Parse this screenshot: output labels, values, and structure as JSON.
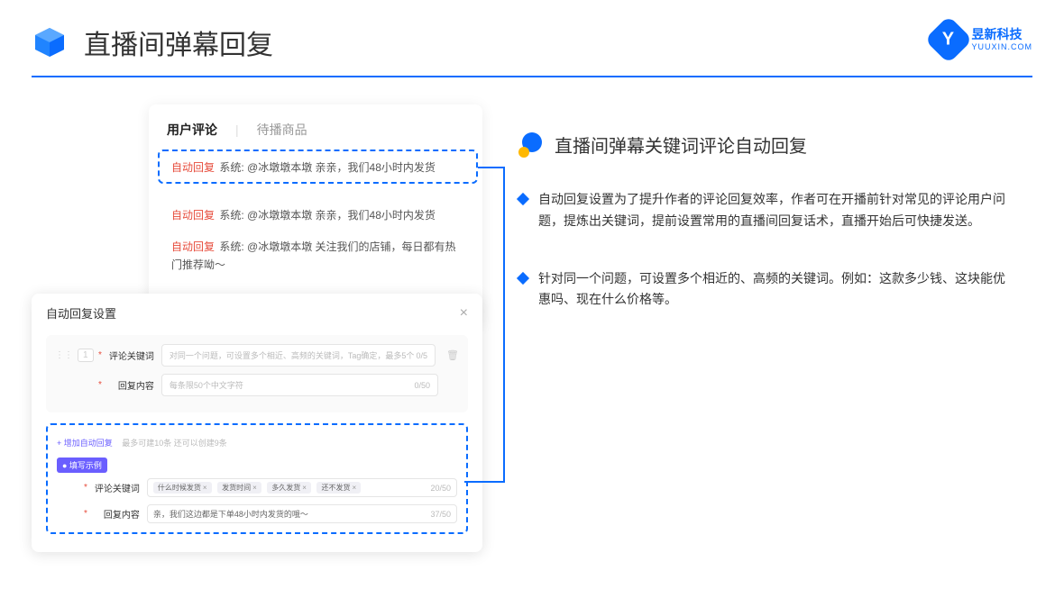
{
  "header": {
    "title": "直播间弹幕回复"
  },
  "brand": {
    "name": "昱新科技",
    "sub": "YUUXIN.COM",
    "icon_letter": "Y"
  },
  "comments": {
    "tab_active": "用户评论",
    "tab_inactive": "待播商品",
    "rows": [
      {
        "label": "自动回复",
        "text": "系统: @冰墩墩本墩 亲亲，我们48小时内发货"
      },
      {
        "label": "自动回复",
        "text": "系统: @冰墩墩本墩 亲亲，我们48小时内发货"
      },
      {
        "label": "自动回复",
        "text": "系统: @冰墩墩本墩 关注我们的店铺，每日都有热门推荐呦～"
      }
    ]
  },
  "settings": {
    "title": "自动回复设置",
    "row_number": "1",
    "keyword_label": "评论关键词",
    "keyword_placeholder": "对同一个问题，可设置多个相近、高频的关键词，Tag确定，最多5个",
    "keyword_counter": "0/5",
    "content_label": "回复内容",
    "content_placeholder": "每条限50个中文字符",
    "content_counter": "0/50",
    "add_link": "+ 增加自动回复",
    "add_hint": "最多可建10条 还可以创建9条",
    "example_badge": "● 填写示例",
    "ex_keyword_label": "评论关键词",
    "ex_tags": [
      "什么时候发货",
      "发货时间",
      "多久发货",
      "还不发货"
    ],
    "ex_keyword_counter": "20/50",
    "ex_content_label": "回复内容",
    "ex_content_value": "亲，我们这边都是下单48小时内发货的哦～",
    "ex_content_counter": "37/50",
    "bottom_counter": "/50"
  },
  "right": {
    "title": "直播间弹幕关键词评论自动回复",
    "bullets": [
      "自动回复设置为了提升作者的评论回复效率，作者可在开播前针对常见的评论用户问题，提炼出关键词，提前设置常用的直播间回复话术，直播开始后可快捷发送。",
      "针对同一个问题，可设置多个相近的、高频的关键词。例如：这款多少钱、这块能优惠吗、现在什么价格等。"
    ]
  }
}
